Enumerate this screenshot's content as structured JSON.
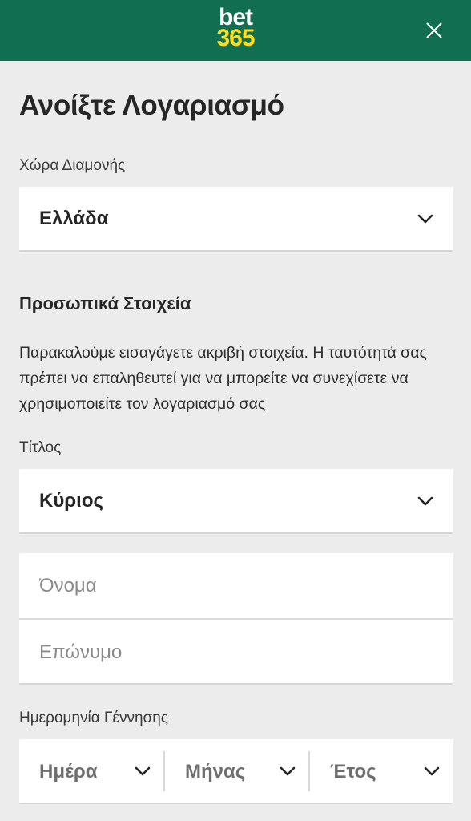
{
  "header": {
    "logo_line1": "bet",
    "logo_line2": "365",
    "bg_color": "#126e51",
    "logo_accent_color": "#ffdf1b",
    "close_icon": "close-icon"
  },
  "page": {
    "title": "Ανοίξτε Λογαριασμό"
  },
  "residence": {
    "label": "Χώρα Διαμονής",
    "value": "Ελλάδα"
  },
  "personal": {
    "section_title": "Προσωπικά Στοιχεία",
    "description": "Παρακαλούμε εισαγάγετε ακριβή στοιχεία. Η ταυτότητά σας πρέπει να επαληθευτεί για να μπορείτε να συνεχίσετε να χρησιμοποιείτε τον λογαριασμό σας",
    "title_label": "Τίτλος",
    "title_value": "Κύριος",
    "first_name_placeholder": "Όνομα",
    "last_name_placeholder": "Επώνυμο"
  },
  "dob": {
    "label": "Ημερομηνία Γέννησης",
    "day": "Ημέρα",
    "month": "Μήνας",
    "year": "Έτος"
  }
}
